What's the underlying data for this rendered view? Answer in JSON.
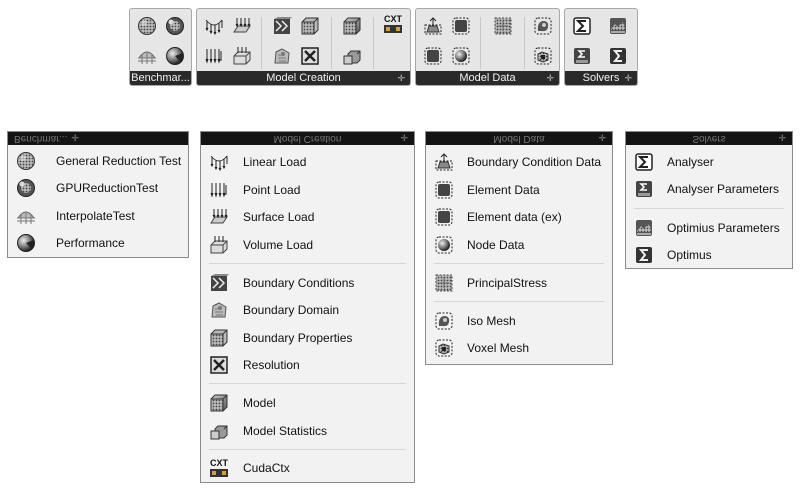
{
  "toolbars": {
    "benchmark": "Benchmar...",
    "model_creation": "Model Creation",
    "model_data": "Model Data",
    "solvers": "Solvers",
    "cxt_label": "CXT",
    "grip": "✛"
  },
  "panels": {
    "benchmark": {
      "header": "Benchmar...",
      "items": [
        "General Reduction Test",
        "GPUReductionTest",
        "InterpolateTest",
        "Performance"
      ]
    },
    "model_creation": {
      "header": "Model Creation",
      "items": [
        "Linear Load",
        "Point Load",
        "Surface Load",
        "Volume Load",
        "Boundary Conditions",
        "Boundary Domain",
        "Boundary Properties",
        "Resolution",
        "Model",
        "Model Statistics",
        "CudaCtx"
      ],
      "cxt_label": "CXT"
    },
    "model_data": {
      "header": "Model Data",
      "items": [
        "Boundary Condition Data",
        "Element Data",
        "Element data (ex)",
        "Node Data",
        "PrincipalStress",
        "Iso Mesh",
        "Voxel Mesh"
      ]
    },
    "solvers": {
      "header": "Solvers",
      "items": [
        "Analyser",
        "Analyser Parameters",
        "Optimius Parameters",
        "Optimus"
      ]
    }
  },
  "colors": {
    "panel_bg": "#f2f2f2",
    "header_bg": "#141414",
    "toolbar_bg": "#e6e6e6",
    "toolbar_bar": "#2a2a2a"
  }
}
